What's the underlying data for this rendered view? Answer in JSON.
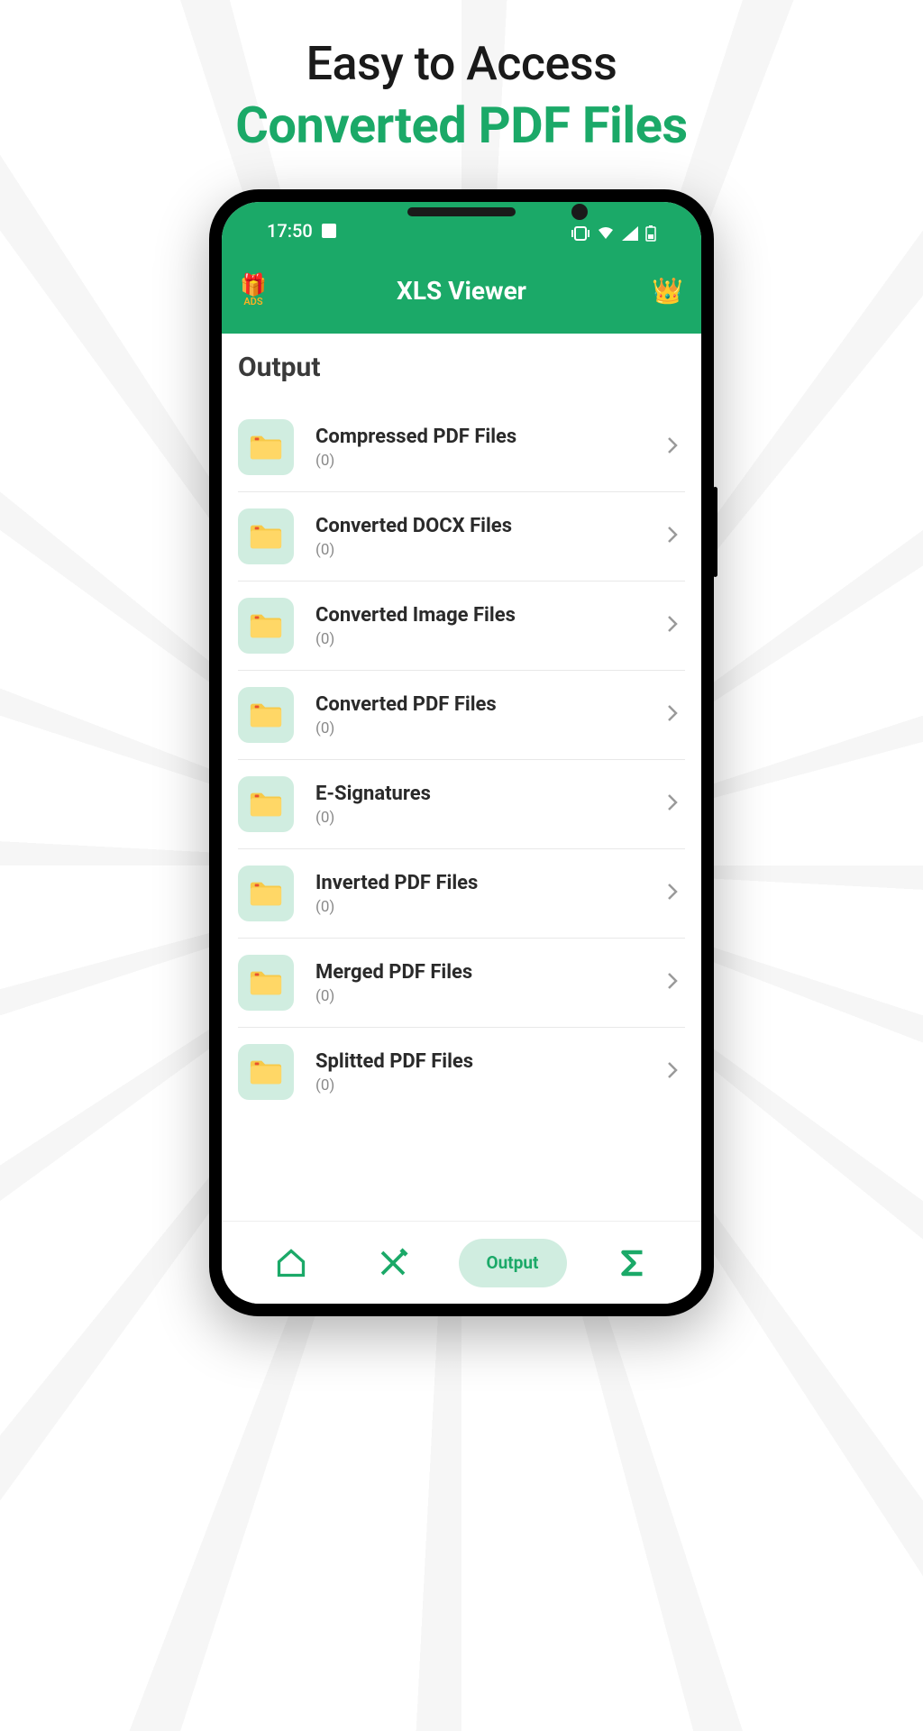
{
  "marketing": {
    "line1": "Easy to Access",
    "line2": "Converted PDF Files"
  },
  "status": {
    "time": "17:50"
  },
  "header": {
    "ads_label": "ADS",
    "title": "XLS Viewer"
  },
  "section": {
    "title": "Output"
  },
  "folders": [
    {
      "name": "Compressed PDF Files",
      "count": "(0)"
    },
    {
      "name": "Converted DOCX Files",
      "count": "(0)"
    },
    {
      "name": "Converted Image Files",
      "count": "(0)"
    },
    {
      "name": "Converted PDF Files",
      "count": "(0)"
    },
    {
      "name": "E-Signatures",
      "count": "(0)"
    },
    {
      "name": "Inverted PDF Files",
      "count": "(0)"
    },
    {
      "name": "Merged PDF Files",
      "count": "(0)"
    },
    {
      "name": "Splitted PDF Files",
      "count": "(0)"
    }
  ],
  "nav": {
    "output_label": "Output"
  }
}
